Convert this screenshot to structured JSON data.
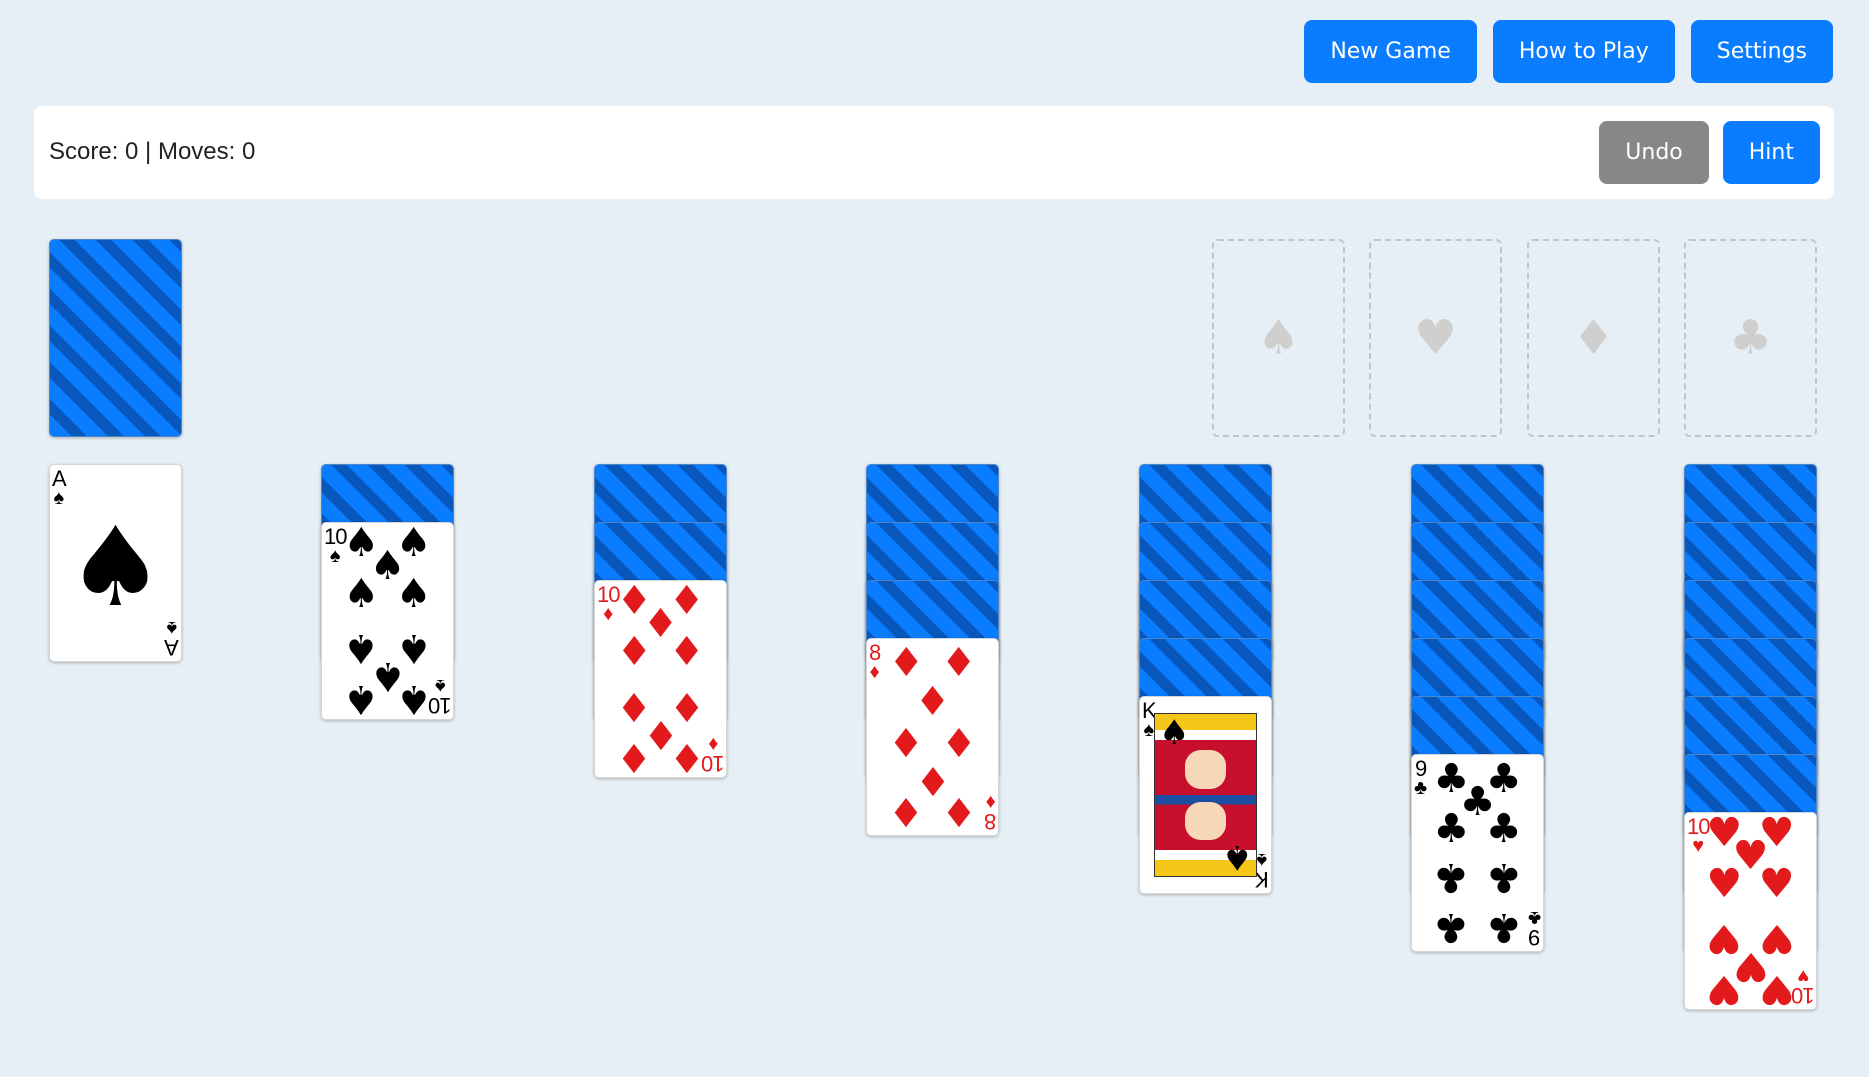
{
  "toolbar": {
    "new_game": "New Game",
    "how_to_play": "How to Play",
    "settings": "Settings"
  },
  "status": {
    "text": "Score: 0 | Moves: 0",
    "undo": "Undo",
    "hint": "Hint"
  },
  "colors": {
    "accent": "#0a7cff",
    "undo_gray": "#878787",
    "background": "#e6eff5",
    "red_suit": "#e31a1c",
    "card_back_dark": "#0757bd"
  },
  "foundations": [
    {
      "suit": "spades",
      "symbol": "♠"
    },
    {
      "suit": "hearts",
      "symbol": "♥"
    },
    {
      "suit": "diamonds",
      "symbol": "♦"
    },
    {
      "suit": "clubs",
      "symbol": "♣"
    }
  ],
  "stock": {
    "face_down": true
  },
  "waste": {
    "rank": "A",
    "suit": "♠",
    "color": "black"
  },
  "tableau": [
    {
      "hidden": 0,
      "top": {
        "rank": "A",
        "suit": "♠",
        "color": "black"
      }
    },
    {
      "hidden": 1,
      "top": {
        "rank": "10",
        "suit": "♠",
        "color": "black"
      }
    },
    {
      "hidden": 2,
      "top": {
        "rank": "10",
        "suit": "♦",
        "color": "red"
      }
    },
    {
      "hidden": 3,
      "top": {
        "rank": "8",
        "suit": "♦",
        "color": "red"
      }
    },
    {
      "hidden": 4,
      "top": {
        "rank": "K",
        "suit": "♠",
        "color": "black"
      }
    },
    {
      "hidden": 5,
      "top": {
        "rank": "9",
        "suit": "♣",
        "color": "black"
      }
    },
    {
      "hidden": 6,
      "top": {
        "rank": "10",
        "suit": "♥",
        "color": "red"
      }
    }
  ]
}
